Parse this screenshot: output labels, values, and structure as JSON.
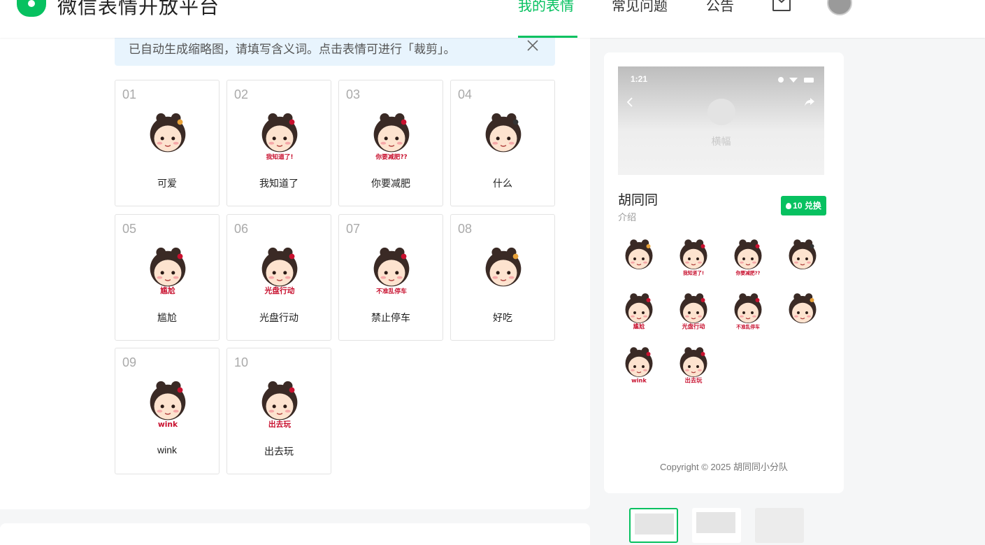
{
  "header": {
    "site_title": "微信表情开放平台",
    "nav": [
      {
        "label": "我的表情",
        "active": true
      },
      {
        "label": "常见问题",
        "active": false
      },
      {
        "label": "公告",
        "active": false
      }
    ],
    "accent_color": "#07c160"
  },
  "notice": {
    "text": "已自动生成缩略图，请填写含义词。点击表情可进行「裁剪」。",
    "background": "#e8f4fd"
  },
  "stickers": [
    {
      "num": "01",
      "label": "可爱",
      "caption": "",
      "color": "#e8a23a"
    },
    {
      "num": "02",
      "label": "我知道了",
      "caption": "我知道了!",
      "color": "#c8102e"
    },
    {
      "num": "03",
      "label": "你要减肥",
      "caption": "你要减肥??",
      "color": "#c8102e"
    },
    {
      "num": "04",
      "label": "什么",
      "caption": "",
      "color": "#333333"
    },
    {
      "num": "05",
      "label": "尴尬",
      "caption": "尴尬",
      "color": "#c8102e"
    },
    {
      "num": "06",
      "label": "光盘行动",
      "caption": "光盘行动",
      "color": "#c8102e"
    },
    {
      "num": "07",
      "label": "禁止停车",
      "caption": "不准乱停车",
      "color": "#c8102e"
    },
    {
      "num": "08",
      "label": "好吃",
      "caption": "",
      "color": "#e8a23a"
    },
    {
      "num": "09",
      "label": "wink",
      "caption": "wink",
      "color": "#c8102e"
    },
    {
      "num": "10",
      "label": "出去玩",
      "caption": "出去玩",
      "color": "#c8102e"
    }
  ],
  "preview": {
    "phone_time": "1:21",
    "banner_label": "横幅",
    "pack_name": "胡同同",
    "intro": "介绍",
    "redeem_label": "10 兑换",
    "copyright": "Copyright © 2025 胡同同小分队"
  }
}
